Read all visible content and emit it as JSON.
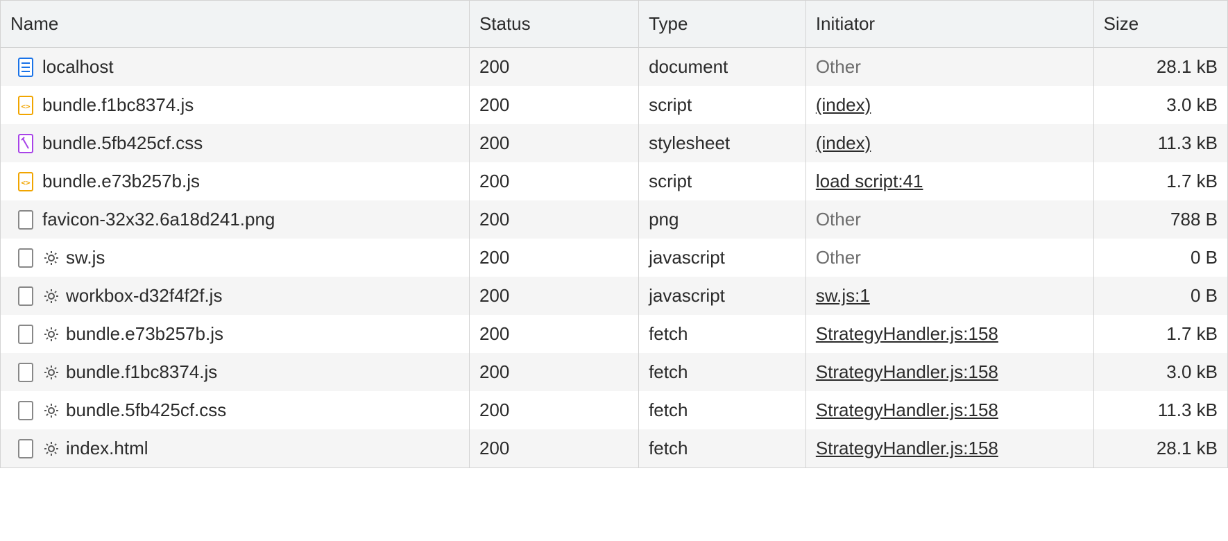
{
  "columns": {
    "name": "Name",
    "status": "Status",
    "type": "Type",
    "initiator": "Initiator",
    "size": "Size"
  },
  "rows": [
    {
      "icon": "document-icon",
      "gear": false,
      "name": "localhost",
      "status": "200",
      "type": "document",
      "initiator": "Other",
      "initiatorLink": false,
      "size": "28.1 kB"
    },
    {
      "icon": "js-icon",
      "gear": false,
      "name": "bundle.f1bc8374.js",
      "status": "200",
      "type": "script",
      "initiator": "(index)",
      "initiatorLink": true,
      "size": "3.0 kB"
    },
    {
      "icon": "css-icon",
      "gear": false,
      "name": "bundle.5fb425cf.css",
      "status": "200",
      "type": "stylesheet",
      "initiator": "(index)",
      "initiatorLink": true,
      "size": "11.3 kB"
    },
    {
      "icon": "js-icon",
      "gear": false,
      "name": "bundle.e73b257b.js",
      "status": "200",
      "type": "script",
      "initiator": "load script:41",
      "initiatorLink": true,
      "size": "1.7 kB"
    },
    {
      "icon": "file-icon",
      "gear": false,
      "name": "favicon-32x32.6a18d241.png",
      "status": "200",
      "type": "png",
      "initiator": "Other",
      "initiatorLink": false,
      "size": "788 B"
    },
    {
      "icon": "file-icon",
      "gear": true,
      "name": "sw.js",
      "status": "200",
      "type": "javascript",
      "initiator": "Other",
      "initiatorLink": false,
      "size": "0 B"
    },
    {
      "icon": "file-icon",
      "gear": true,
      "name": "workbox-d32f4f2f.js",
      "status": "200",
      "type": "javascript",
      "initiator": "sw.js:1",
      "initiatorLink": true,
      "size": "0 B"
    },
    {
      "icon": "file-icon",
      "gear": true,
      "name": "bundle.e73b257b.js",
      "status": "200",
      "type": "fetch",
      "initiator": "StrategyHandler.js:158",
      "initiatorLink": true,
      "size": "1.7 kB"
    },
    {
      "icon": "file-icon",
      "gear": true,
      "name": "bundle.f1bc8374.js",
      "status": "200",
      "type": "fetch",
      "initiator": "StrategyHandler.js:158",
      "initiatorLink": true,
      "size": "3.0 kB"
    },
    {
      "icon": "file-icon",
      "gear": true,
      "name": "bundle.5fb425cf.css",
      "status": "200",
      "type": "fetch",
      "initiator": "StrategyHandler.js:158",
      "initiatorLink": true,
      "size": "11.3 kB"
    },
    {
      "icon": "file-icon",
      "gear": true,
      "name": "index.html",
      "status": "200",
      "type": "fetch",
      "initiator": "StrategyHandler.js:158",
      "initiatorLink": true,
      "size": "28.1 kB"
    }
  ]
}
